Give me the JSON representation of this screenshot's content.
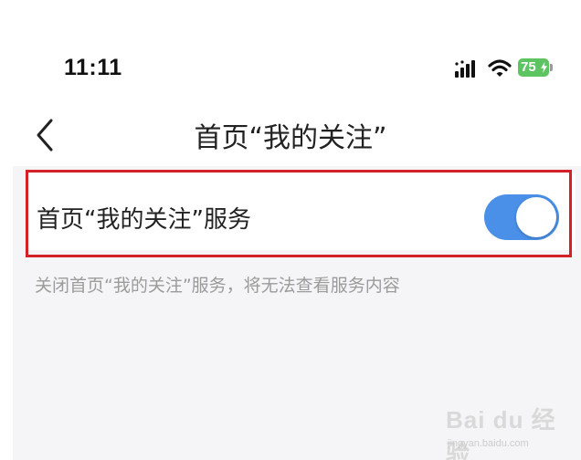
{
  "status_bar": {
    "time": "11:11",
    "battery_level": "75",
    "battery_color": "#5cc460",
    "icons": [
      "signal-icon",
      "wifi-icon",
      "battery-icon"
    ]
  },
  "nav": {
    "back_icon": "chevron-left-icon",
    "title": "首页“我的关注”"
  },
  "settings": {
    "row_label": "首页“我的关注”服务",
    "toggle_on": true,
    "toggle_color": "#4a90e8",
    "hint": "关闭首页“我的关注”服务，将无法查看服务内容",
    "highlight_color": "#d42027"
  },
  "watermark": {
    "logo": "Bai du 经验",
    "url": "jingyan.baidu.com"
  }
}
